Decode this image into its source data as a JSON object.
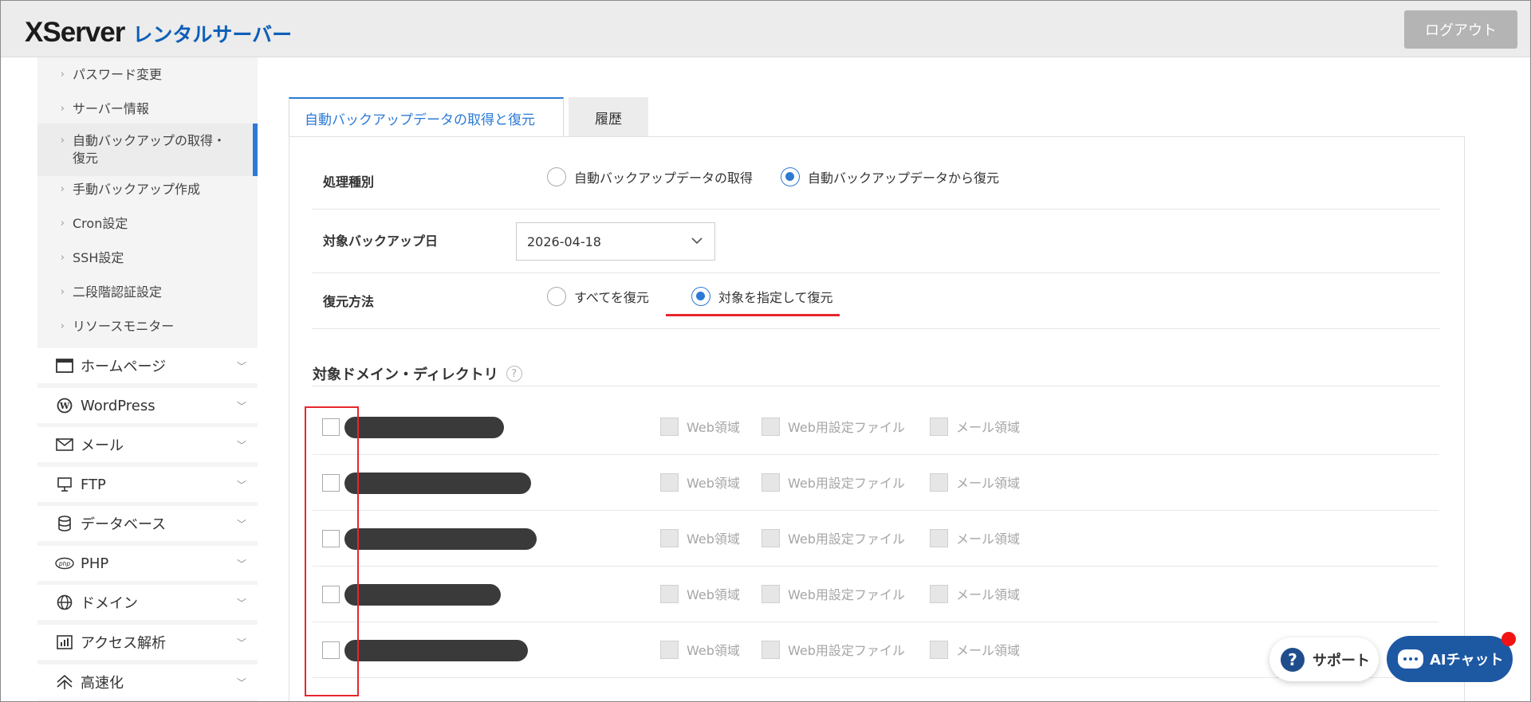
{
  "header": {
    "logo_main": "XServer",
    "logo_sub": "レンタルサーバー",
    "logout_label": "ログアウト"
  },
  "sidebar": {
    "sub_items": [
      {
        "label": "パスワード変更",
        "active": false
      },
      {
        "label": "サーバー情報",
        "active": false
      },
      {
        "label": "自動バックアップの取得・\n復元",
        "label_line1": "自動バックアップの取得・",
        "label_line2": "復元",
        "active": true
      },
      {
        "label": "手動バックアップ作成",
        "active": false
      },
      {
        "label": "Cron設定",
        "active": false
      },
      {
        "label": "SSH設定",
        "active": false
      },
      {
        "label": "二段階認証設定",
        "active": false
      },
      {
        "label": "リソースモニター",
        "active": false
      }
    ],
    "main_items": [
      {
        "label": "ホームページ",
        "icon": "browser-window-icon"
      },
      {
        "label": "WordPress",
        "icon": "wordpress-icon"
      },
      {
        "label": "メール",
        "icon": "mail-icon"
      },
      {
        "label": "FTP",
        "icon": "ftp-monitor-icon"
      },
      {
        "label": "データベース",
        "icon": "database-icon"
      },
      {
        "label": "PHP",
        "icon": "php-icon"
      },
      {
        "label": "ドメイン",
        "icon": "globe-icon"
      },
      {
        "label": "アクセス解析",
        "icon": "chart-icon"
      },
      {
        "label": "高速化",
        "icon": "speed-icon"
      }
    ]
  },
  "tabs": {
    "restore": "自動バックアップデータの取得と復元",
    "history": "履歴"
  },
  "form": {
    "process_type_label": "処理種別",
    "process_options": [
      "自動バックアップデータの取得",
      "自動バックアップデータから復元"
    ],
    "process_selected": 1,
    "backup_date_label": "対象バックアップ日",
    "backup_date_value": "2026-04-18",
    "restore_method_label": "復元方法",
    "restore_options": [
      "すべてを復元",
      "対象を指定して復元"
    ],
    "restore_selected": 1,
    "target_section_title": "対象ドメイン・ディレクトリ",
    "help_icon": "?"
  },
  "domain_rows": {
    "option_labels": [
      "Web領域",
      "Web用設定ファイル",
      "メール領域"
    ],
    "count": 5
  },
  "floating": {
    "support_label": "サポート",
    "ai_chat_label": "AIチャット"
  },
  "colors": {
    "accent": "#2c7ad6",
    "brand": "#0d5fb8",
    "highlight": "#e8262e",
    "chat_button": "#1d58a3"
  }
}
